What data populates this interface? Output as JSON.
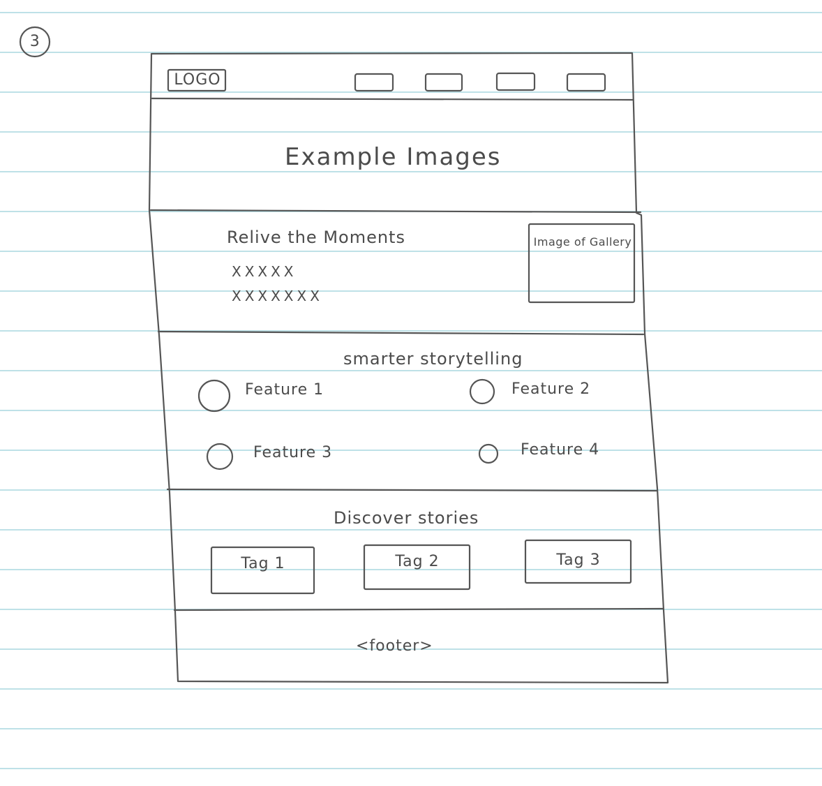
{
  "page": {
    "number": "3"
  },
  "header": {
    "logo": "LOGO",
    "nav_items": [
      "",
      "",
      "",
      ""
    ]
  },
  "hero": {
    "title": "Example Images"
  },
  "intro": {
    "heading": "Relive the Moments",
    "lines": [
      "XXXXX",
      "XXXXXXX"
    ],
    "gallery_image_label": "Image of Gallery"
  },
  "features": {
    "heading": "smarter storytelling",
    "items": [
      "Feature 1",
      "Feature 2",
      "Feature 3",
      "Feature 4"
    ]
  },
  "stories": {
    "heading": "Discover stories",
    "tags": [
      "Tag 1",
      "Tag 2",
      "Tag 3"
    ]
  },
  "footer": {
    "label": "<footer>"
  },
  "colors": {
    "paper_line": "#a9d7df",
    "pencil": "#555555"
  }
}
